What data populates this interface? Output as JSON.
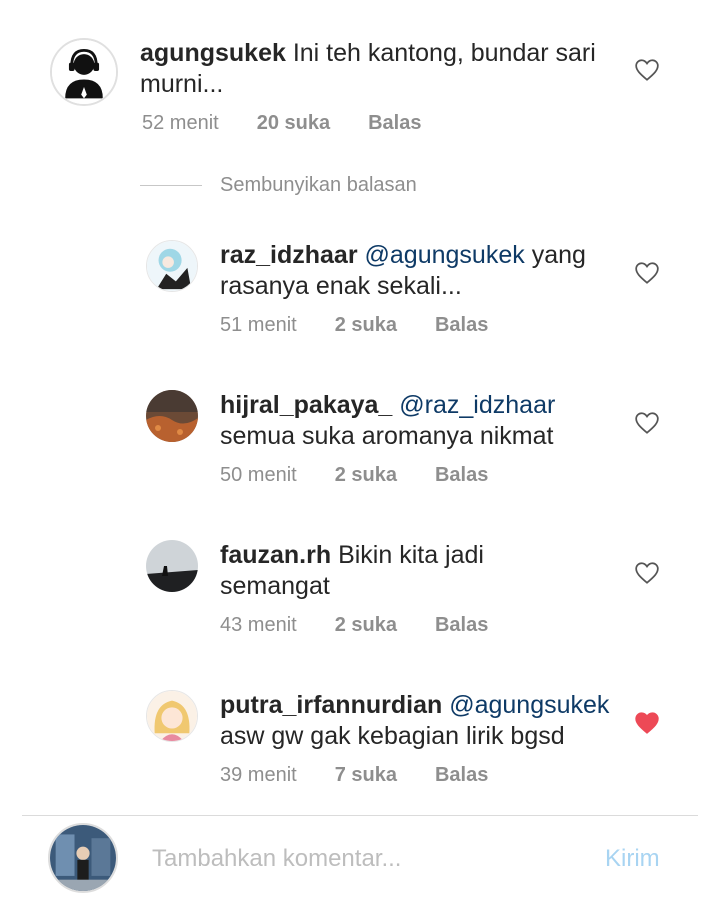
{
  "comments": [
    {
      "username": "agungsukek",
      "mention": "",
      "body": "Ini teh kantong, bundar sari",
      "body2": "murni...",
      "time": "52 menit",
      "likes": "20 suka",
      "reply": "Balas",
      "liked": false
    },
    {
      "username": "raz_idzhaar",
      "mention": "@agungsukek",
      "body": "yang",
      "body2": "rasanya enak sekali...",
      "time": "51 menit",
      "likes": "2 suka",
      "reply": "Balas",
      "liked": false
    },
    {
      "username": "hijral_pakaya_",
      "mention": "@raz_idzhaar",
      "body": "",
      "body2": "semua suka aromanya nikmat",
      "time": "50 menit",
      "likes": "2 suka",
      "reply": "Balas",
      "liked": false
    },
    {
      "username": "fauzan.rh",
      "mention": "",
      "body": "Bikin kita jadi",
      "body2": "semangat",
      "time": "43 menit",
      "likes": "2 suka",
      "reply": "Balas",
      "liked": false
    },
    {
      "username": "putra_irfannurdian",
      "mention": "@agungsukek",
      "body": "",
      "body2": "asw gw gak kebagian lirik bgsd",
      "time": "39 menit",
      "likes": "7 suka",
      "reply": "Balas",
      "liked": true
    }
  ],
  "hide_replies_label": "Sembunyikan balasan",
  "composer": {
    "placeholder": "Tambahkan komentar...",
    "send_label": "Kirim"
  },
  "colors": {
    "liked_heart": "#ed4956",
    "send": "#a8d4f2",
    "mention": "#0e3a66"
  }
}
